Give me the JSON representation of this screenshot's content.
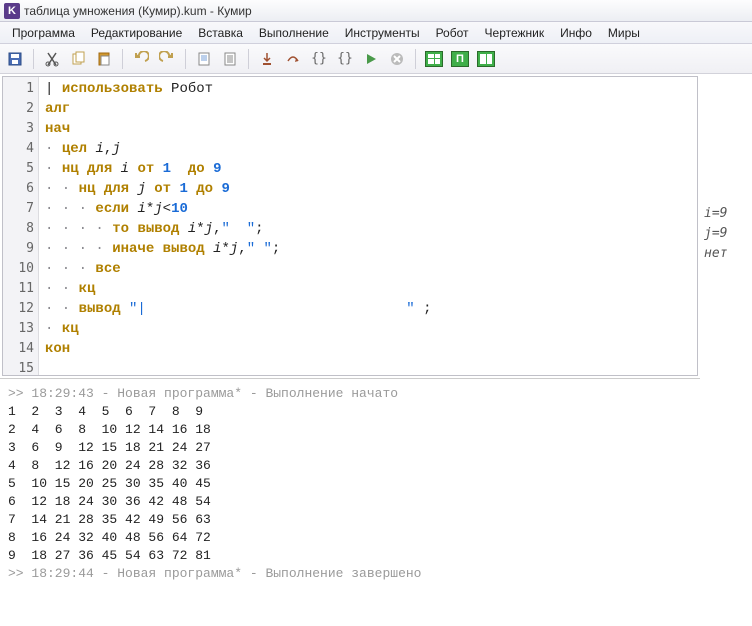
{
  "window": {
    "title": "таблица умножения (Кумир).kum - Кумир",
    "icon_letter": "K"
  },
  "menu": {
    "items": [
      "Программа",
      "Редактирование",
      "Вставка",
      "Выполнение",
      "Инструменты",
      "Робот",
      "Чертежник",
      "Инфо",
      "Миры"
    ]
  },
  "toolbar": {
    "icons": [
      {
        "name": "save-icon"
      },
      {
        "name": "sep"
      },
      {
        "name": "cut-icon"
      },
      {
        "name": "copy-icon"
      },
      {
        "name": "paste-icon"
      },
      {
        "name": "sep"
      },
      {
        "name": "undo-icon"
      },
      {
        "name": "redo-icon"
      },
      {
        "name": "sep"
      },
      {
        "name": "page-icon"
      },
      {
        "name": "page-lines-icon"
      },
      {
        "name": "sep"
      },
      {
        "name": "step-into-icon"
      },
      {
        "name": "step-over-icon"
      },
      {
        "name": "braces-run-icon"
      },
      {
        "name": "braces-step-icon"
      },
      {
        "name": "run-icon"
      },
      {
        "name": "stop-icon"
      },
      {
        "name": "sep"
      },
      {
        "name": "grid-4-icon"
      },
      {
        "name": "grid-p-icon"
      },
      {
        "name": "grid-2-icon"
      }
    ]
  },
  "editor": {
    "lines": [
      {
        "n": 1,
        "indent": "",
        "html": "| <span class='kw'>использовать</span> Робот"
      },
      {
        "n": 2,
        "indent": "",
        "html": "<span class='kw'>алг</span>"
      },
      {
        "n": 3,
        "indent": "",
        "html": "<span class='kw'>нач</span>"
      },
      {
        "n": 4,
        "indent": "·",
        "html": "<span class='kw'>цел</span> <span class='it'>i</span>,<span class='it'>j</span>"
      },
      {
        "n": 5,
        "indent": "·",
        "html": "<span class='kw'>нц для</span> <span class='it'>i</span> <span class='kw'>от</span> <span class='num'>1</span>  <span class='kw'>до</span> <span class='num'>9</span>"
      },
      {
        "n": 6,
        "indent": "· ·",
        "html": "<span class='kw'>нц для</span> <span class='it'>j</span> <span class='kw'>от</span> <span class='num'>1</span> <span class='kw'>до</span> <span class='num'>9</span>"
      },
      {
        "n": 7,
        "indent": "· · ·",
        "html": "<span class='kw'>если</span> <span class='it'>i</span>*<span class='it'>j</span>&lt;<span class='num'>10</span>"
      },
      {
        "n": 8,
        "indent": "· · · ·",
        "html": "<span class='kw'>то</span> <span class='kw'>вывод</span> <span class='it'>i</span>*<span class='it'>j</span>,<span class='str'>\"  \"</span>;"
      },
      {
        "n": 9,
        "indent": "· · · ·",
        "html": "<span class='kw'>иначе</span> <span class='kw'>вывод</span> <span class='it'>i</span>*<span class='it'>j</span>,<span class='str'>\" \"</span>;"
      },
      {
        "n": 10,
        "indent": "· · ·",
        "html": "<span class='kw'>все</span>"
      },
      {
        "n": 11,
        "indent": "· ·",
        "html": "<span class='kw'>кц</span>"
      },
      {
        "n": 12,
        "indent": "· ·",
        "html": "<span class='kw'>вывод</span> <span class='str'>\"|</span>                               <span class='str'>\"</span> ;"
      },
      {
        "n": 13,
        "indent": "·",
        "html": "<span class='kw'>кц</span>"
      },
      {
        "n": 14,
        "indent": "",
        "html": "<span class='kw'>кон</span>"
      },
      {
        "n": 15,
        "indent": "",
        "html": ""
      }
    ]
  },
  "watches": {
    "rows": [
      "i=9",
      "j=9",
      "нет"
    ]
  },
  "output": {
    "start": ">> 18:29:43 - Новая программа* - Выполнение начато",
    "rows": [
      "1  2  3  4  5  6  7  8  9",
      "2  4  6  8  10 12 14 16 18",
      "3  6  9  12 15 18 21 24 27",
      "4  8  12 16 20 24 28 32 36",
      "5  10 15 20 25 30 35 40 45",
      "6  12 18 24 30 36 42 48 54",
      "7  14 21 28 35 42 49 56 63",
      "8  16 24 32 40 48 56 64 72",
      "9  18 27 36 45 54 63 72 81"
    ],
    "end": ">> 18:29:44 - Новая программа* - Выполнение завершено"
  }
}
